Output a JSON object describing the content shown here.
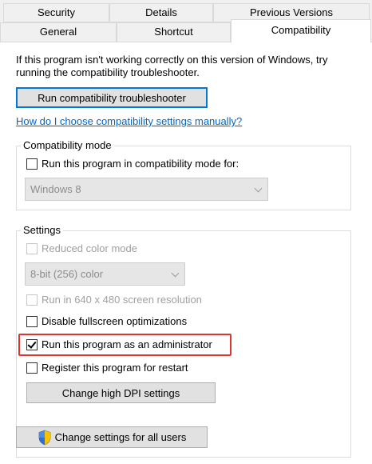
{
  "tabs": {
    "row1": [
      "Security",
      "Details",
      "Previous Versions"
    ],
    "row2": [
      "General",
      "Shortcut",
      "Compatibility"
    ]
  },
  "intro_text": "If this program isn't working correctly on this version of Windows, try running the compatibility troubleshooter.",
  "troubleshooter_button": "Run compatibility troubleshooter",
  "help_link": "How do I choose compatibility settings manually?",
  "compat_mode": {
    "legend": "Compatibility mode",
    "checkbox_label": "Run this program in compatibility mode for:",
    "checked": false,
    "os_select": "Windows 8"
  },
  "settings": {
    "legend": "Settings",
    "reduced_color": {
      "label": "Reduced color mode",
      "checked": false,
      "disabled": true
    },
    "color_select": "8-bit (256) color",
    "res640": {
      "label": "Run in 640 x 480 screen resolution",
      "checked": false,
      "disabled": true
    },
    "fullscreen_opt": {
      "label": "Disable fullscreen optimizations",
      "checked": false
    },
    "run_as_admin": {
      "label": "Run this program as an administrator",
      "checked": true
    },
    "register_restart": {
      "label": "Register this program for restart",
      "checked": false
    },
    "dpi_button": "Change high DPI settings"
  },
  "all_users_button": "Change settings for all users",
  "colors": {
    "link": "#0066cc",
    "highlight": "#e0342e",
    "focus": "#0078d7",
    "button_bg": "#e1e1e1"
  },
  "icons": {
    "all_users": "uac-shield-icon"
  }
}
